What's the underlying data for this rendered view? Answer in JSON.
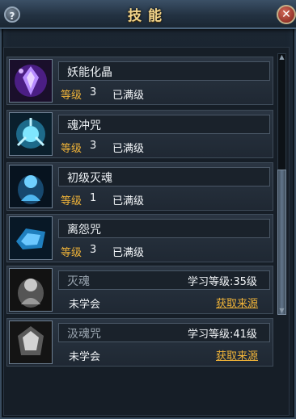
{
  "window": {
    "title": "技能",
    "help_label": "?",
    "close_label": "✕"
  },
  "skills": [
    {
      "name": "妖能化晶",
      "level_label": "等级",
      "level": "3",
      "status": "已满级",
      "icon": "purple-crystal-skill-icon",
      "accent": "#b78cff"
    },
    {
      "name": "魂冲咒",
      "level_label": "等级",
      "level": "3",
      "status": "已满级",
      "icon": "cyan-spirit-burst-skill-icon",
      "accent": "#7fe6ff"
    },
    {
      "name": "初级灭魂",
      "level_label": "等级",
      "level": "1",
      "status": "已满级",
      "icon": "blue-spirit-skill-icon",
      "accent": "#6fd0ff"
    },
    {
      "name": "离怨咒",
      "level_label": "等级",
      "level": "3",
      "status": "已满级",
      "icon": "ice-stone-skill-icon",
      "accent": "#6cc8ff"
    },
    {
      "name": "灭魂",
      "requirement": "学习等级:35级",
      "status": "未学会",
      "action": "获取来源",
      "icon": "gray-spirit-skill-icon",
      "accent": "#c8c8c8"
    },
    {
      "name": "汲魂咒",
      "requirement": "学习等级:41级",
      "status": "未学会",
      "action": "获取来源",
      "icon": "gray-shield-skill-icon",
      "accent": "#d4d4d4"
    }
  ],
  "colors": {
    "gold": "#f0b338",
    "title_gold": "#f2d48a"
  }
}
